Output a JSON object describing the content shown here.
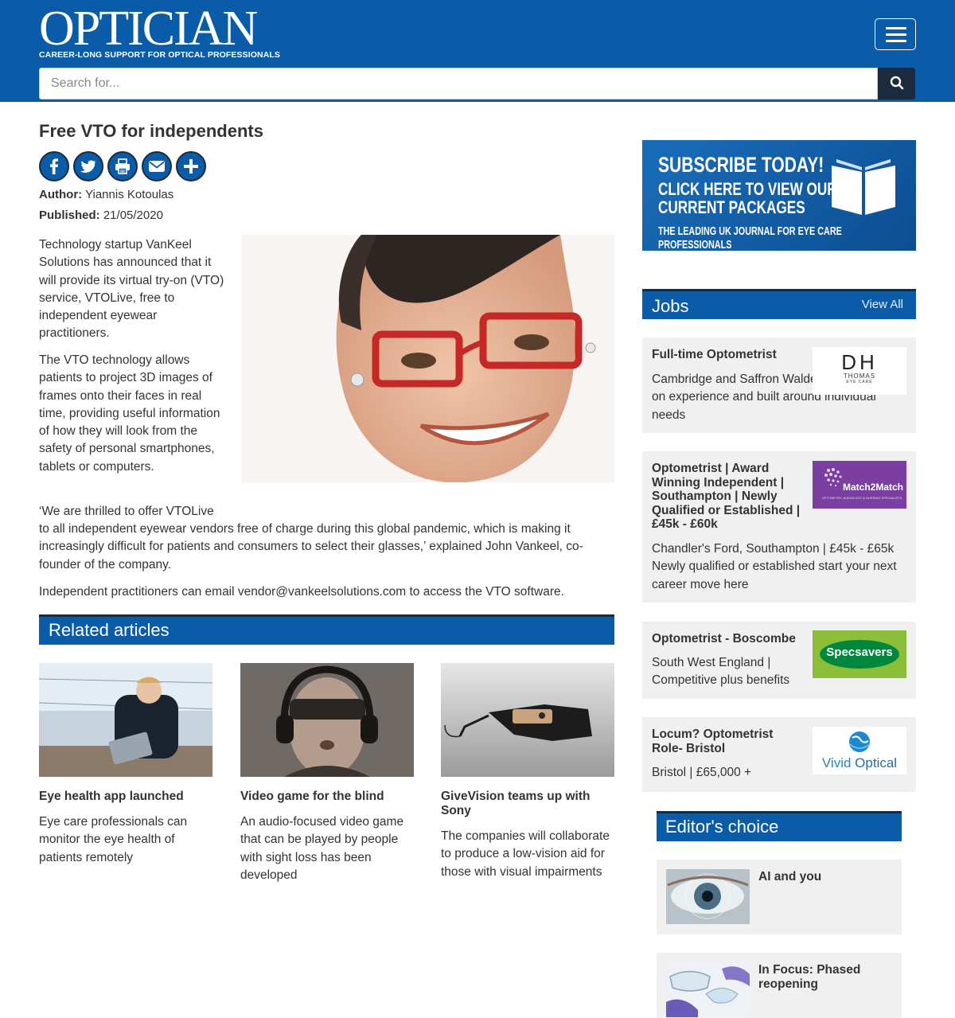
{
  "header": {
    "logo_word": "OPTICIAN",
    "logo_tagline": "CAREER-LONG SUPPORT FOR OPTICAL PROFESSIONALS",
    "search_placeholder": "Search for...",
    "brand_color": "#0a5ca8",
    "dark_color": "#1b2a3c"
  },
  "article": {
    "title": "Free VTO for independents",
    "share_icons": [
      "facebook-icon",
      "twitter-icon",
      "print-icon",
      "email-icon",
      "plus-icon"
    ],
    "author_label": "Author:",
    "author": "Yiannis Kotoulas",
    "published_label": "Published:",
    "published": "21/05/2020",
    "paragraphs": [
      "Technology startup VanKeel Solutions has announced that it will provide its virtual try-on (VTO) service, VTOLive, free to independent eyewear practitioners.",
      "The VTO technology allows patients to project 3D images of frames onto their faces in real time, providing useful information of how they will look from the safety of personal smartphones, tablets or computers.",
      "‘We are thrilled to offer VTOLive",
      "to all independent eyewear vendors free of charge during this global pandemic, which is making it increasingly difficult for patients and consumers to select their glasses,’ explained John Vankeel, co-founder of the company.",
      "Independent practitioners can email vendor@vankeelsolutions.com to access the VTO software."
    ]
  },
  "related": {
    "heading": "Related articles",
    "items": [
      {
        "title": "Eye health app launched",
        "desc": "Eye care professionals can monitor the eye health of patients remotely"
      },
      {
        "title": "Video game for the blind",
        "desc": "An audio-focused video game that can be played by people with sight loss has been developed"
      },
      {
        "title": "GiveVision teams up with Sony",
        "desc": "The companies will collaborate to produce a low-vision aid for those with visual impairments"
      }
    ]
  },
  "subscribe": {
    "line1": "SUBSCRIBE TODAY!",
    "line2": "CLICK HERE TO VIEW OUR",
    "line3": "CURRENT PACKAGES",
    "line4": "THE LEADING UK JOURNAL FOR EYE CARE PROFESSIONALS"
  },
  "jobs": {
    "heading": "Jobs",
    "view_all": "View All",
    "items": [
      {
        "title": "Full-time Optometrist",
        "desc": "Cambridge and Saffron Walden | Dependent on experience and built around individual needs",
        "logo_text": "DH",
        "logo_sub": "THOMAS",
        "logo_sub2": "EYE CARE"
      },
      {
        "title": "Optometrist | Award Winning Independent | Southampton | Newly Qualified or Established | £45k - £60k",
        "desc": "Chandler's Ford, Southampton | £45k - £65k Newly qualified or established start your next career move here",
        "logo_text": "Match2Match",
        "logo_sub": "OPTOMETRY, AUDIOLOGY & NURSING SPECIALISTS"
      },
      {
        "title": "Optometrist - Boscombe",
        "desc": "South West England | Competitive plus benefits",
        "logo_text": "Specsavers"
      },
      {
        "title": "Locum? Optometrist Role- Bristol",
        "desc": "Bristol | £65,000 +",
        "logo_text": "Vivid",
        "logo_text2": "Optical"
      }
    ]
  },
  "editors_choice": {
    "heading": "Editor's choice",
    "items": [
      {
        "title": "AI and you"
      },
      {
        "title": "In Focus: Phased reopening"
      }
    ]
  }
}
